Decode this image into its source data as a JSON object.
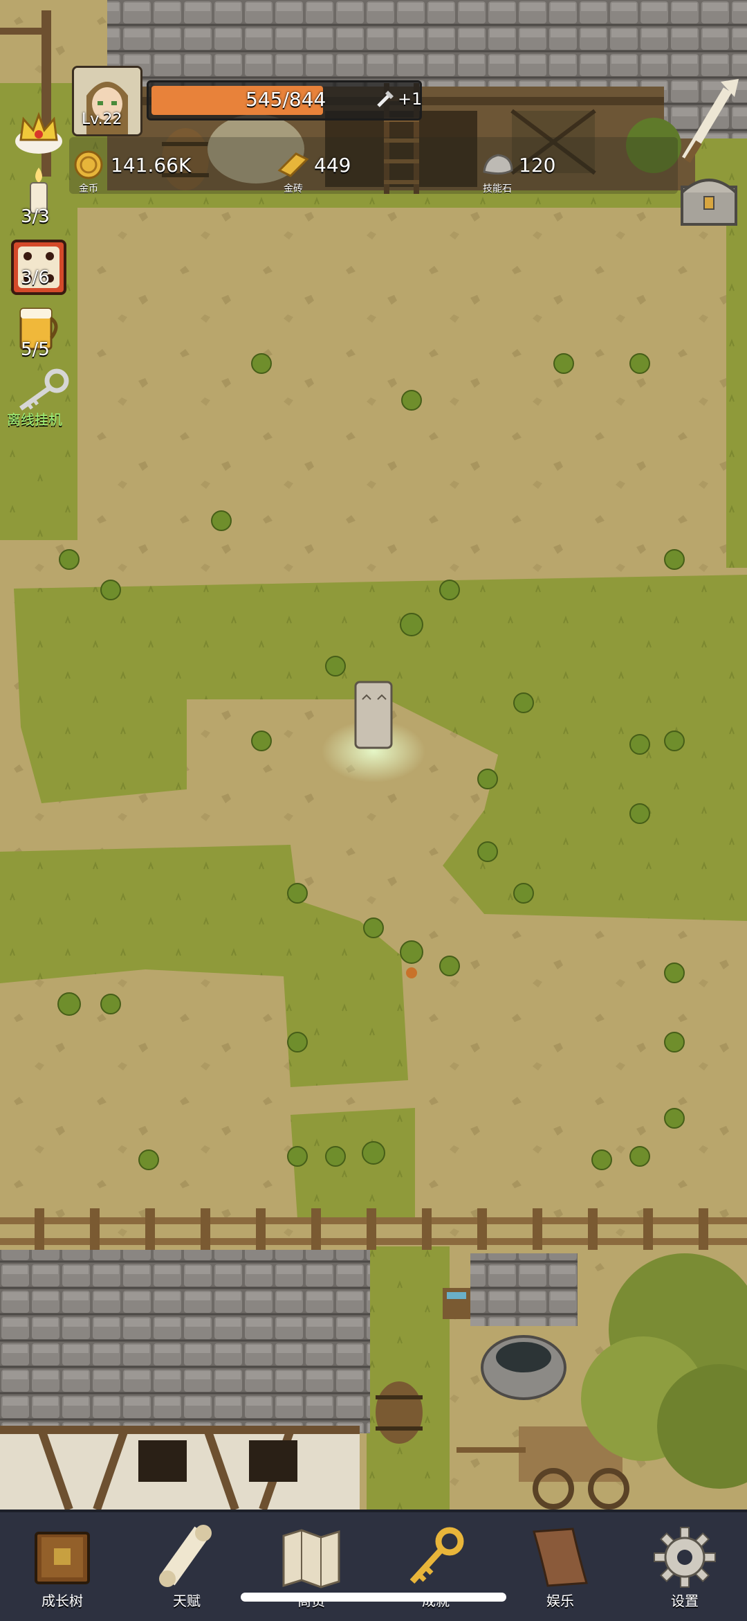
{
  "player": {
    "level": "Lv.22",
    "exp_text": "545/844",
    "exp_progress": 0.646,
    "bonus_text": "+1"
  },
  "resources": [
    {
      "icon": "gold-coin-icon",
      "value": "141.66K",
      "label": "金币"
    },
    {
      "icon": "gold-brick-icon",
      "value": "449",
      "label": "金砖"
    },
    {
      "icon": "skill-stone-icon",
      "value": "120",
      "label": "技能石"
    }
  ],
  "side_buttons": [
    {
      "icon": "crown-icon",
      "count": ""
    },
    {
      "icon": "candle-icon",
      "count": "3/3"
    },
    {
      "icon": "dice-icon",
      "count": "3/6"
    },
    {
      "icon": "beer-mug-icon",
      "count": "5/5"
    },
    {
      "icon": "key-icon",
      "count": "",
      "label": "离线挂机"
    }
  ],
  "nav": [
    {
      "icon": "book-icon",
      "label": "成长树"
    },
    {
      "icon": "scroll-icon",
      "label": "天赋"
    },
    {
      "icon": "map-icon",
      "label": "商贸"
    },
    {
      "icon": "golden-key-icon",
      "label": "成就"
    },
    {
      "icon": "parchment-icon",
      "label": "娱乐"
    },
    {
      "icon": "gear-icon",
      "label": "设置"
    }
  ],
  "colors": {
    "grass": "#8f9a3a",
    "dirt": "#b7a46a",
    "exp_fill": "#e8823a",
    "nav_bg": "#2d3140",
    "offline_label": "#9cf27a"
  }
}
